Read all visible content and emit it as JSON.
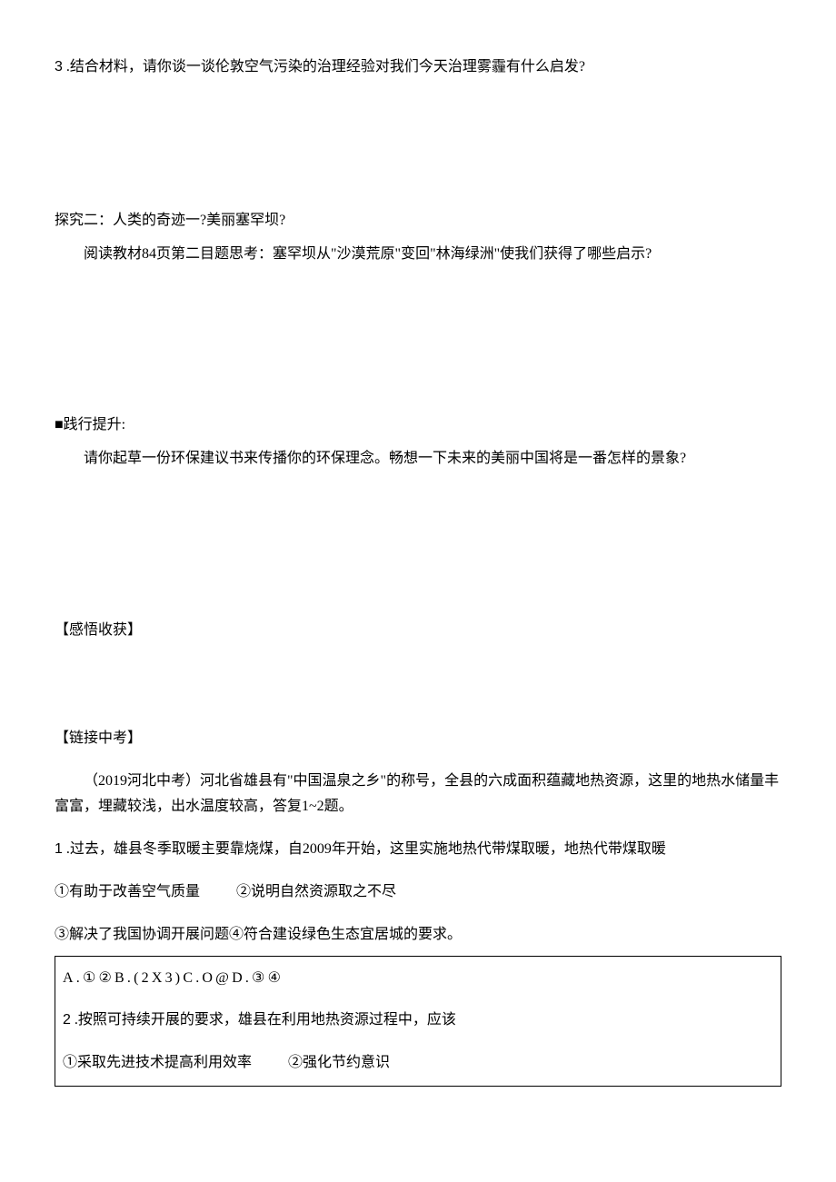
{
  "q3": {
    "num": "3",
    "text": " .结合材料，请你谈一谈伦敦空气污染的治理经验对我们今天治理雾霾有什么启发?"
  },
  "tanjiu2": {
    "title": "探究二：人类的奇迹一?美丽塞罕坝?",
    "body": "阅读教材84页第二目题思考：塞罕坝从\"沙漠荒原\"变回\"林海绿洲\"使我们获得了哪些启示?"
  },
  "jianxing": {
    "title": "■践行提升:",
    "body": "请你起草一份环保建议书来传播你的环保理念。畅想一下未来的美丽中国将是一番怎样的景象?"
  },
  "ganwu": {
    "title": "【感悟收获】"
  },
  "lianjie": {
    "title": "【链接中考】",
    "intro": "（2019河北中考）河北省雄县有\"中国温泉之乡\"的称号，全县的六成面积蕴藏地热资源，这里的地热水储量丰富富，埋藏较浅，出水温度较高，答复1~2题。",
    "q1": {
      "num": "1",
      "text": " .过去，雄县冬季取暖主要靠烧煤，自2009年开始，这里实施地热代带煤取暖，地热代带煤取暖",
      "line2_a": "①有助于改善空气质量",
      "line2_b": "②说明自然资源取之不尽",
      "line3": "③解决了我国协调开展问题④符合建设绿色生态宜居城的要求。"
    },
    "box": {
      "options": "A.①②B.(2X3)C.O@D.③④",
      "q2": {
        "num": "2",
        "text": " .按照可持续开展的要求，雄县在利用地热资源过程中，应该"
      },
      "line3_a": "①采取先进技术提高利用效率",
      "line3_b": "②强化节约意识"
    }
  }
}
